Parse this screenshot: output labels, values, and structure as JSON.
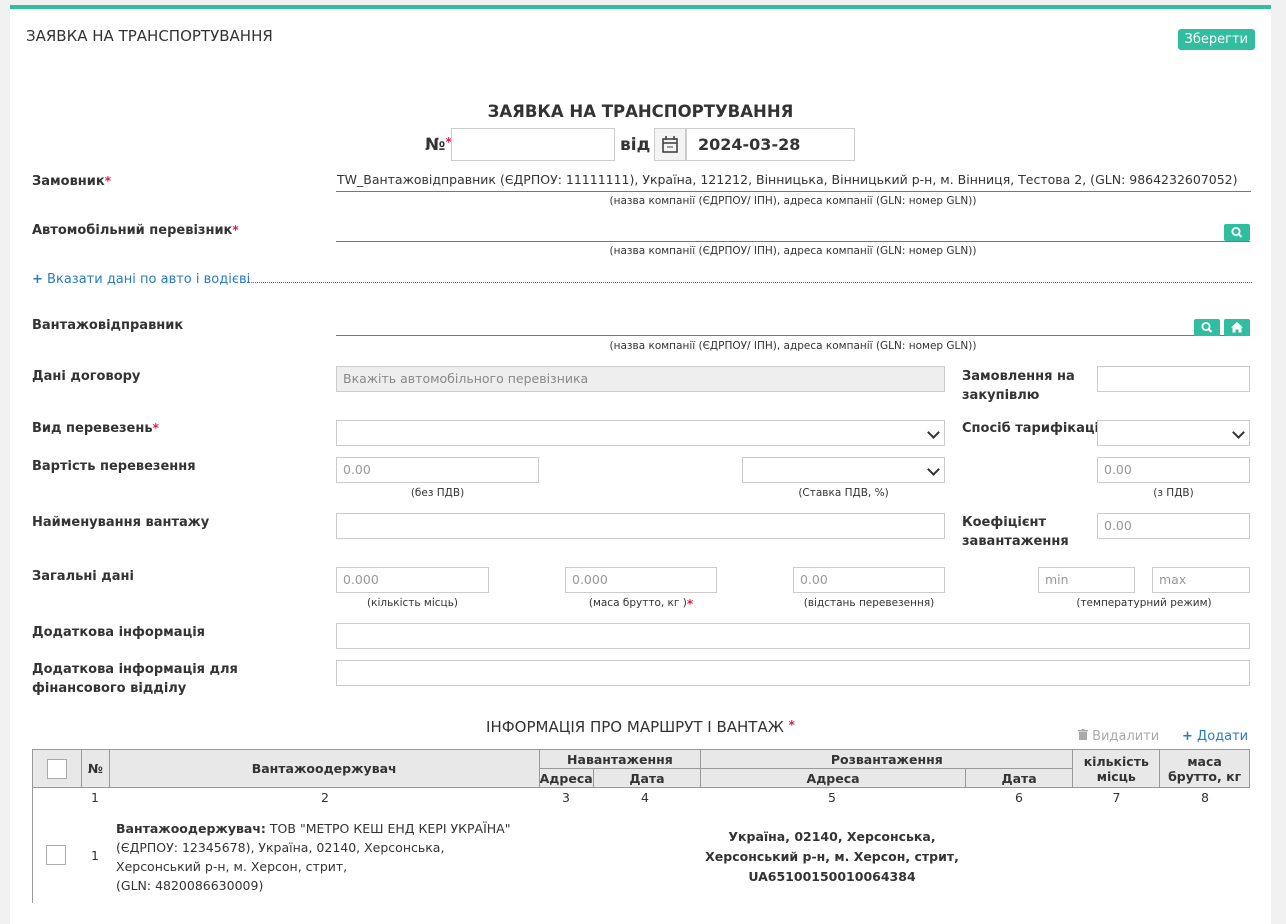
{
  "header": {
    "title": "ЗАЯВКА НА ТРАНСПОРТУВАННЯ",
    "save_label": "Зберегти"
  },
  "doc": {
    "title": "ЗАЯВКА НА ТРАНСПОРТУВАННЯ",
    "number_label": "№",
    "number_value": "",
    "date_label": "від",
    "date_value": "2024-03-28"
  },
  "form": {
    "customer_label": "Замовник",
    "customer_value": "TW_Вантажовідправник (ЄДРПОУ: 11111111), Україна, 121212, Вінницька, Вінницький р-н, м. Вінниця, Тестова 2, (GLN: 9864232607052)",
    "company_hint": "(назва компанії (ЄДРПОУ/ ІПН), адреса компанії (GLN: номер GLN))",
    "carrier_label": "Автомобільний перевізник",
    "carrier_value": "",
    "vehicle_link": "Вказати дані по авто і водієві",
    "shipper_label": "Вантажовідправник",
    "shipper_value": "",
    "contract_label": "Дані договору",
    "contract_placeholder": "Вкажіть автомобільного перевізника",
    "purchase_order_label": "Замовлення на закупівлю",
    "transport_type_label": "Вид перевезень",
    "tariff_label": "Спосіб тарифікації",
    "cost_label": "Вартість перевезення",
    "cost_value": "0.00",
    "cost_hint": "(без ПДВ)",
    "vat_hint": "(Ставка ПДВ, %)",
    "cost_vat_value": "0.00",
    "cost_vat_hint": "(з ПДВ)",
    "cargo_name_label": "Найменування вантажу",
    "load_coef_label": "Коефіцієнт завантаження",
    "load_coef_value": "0.00",
    "general_label": "Загальні дані",
    "places_value": "0.000",
    "places_hint": "(кількість місць)",
    "gross_value": "0.000",
    "gross_hint": "(маса брутто, кг )",
    "distance_value": "0.00",
    "distance_hint": "(відстань перевезення)",
    "temp_min": "min",
    "temp_max": "max",
    "temp_hint": "(температурний режим)",
    "extra_label": "Додаткова інформація",
    "extra_fin_label": "Додаткова інформація для фінансового відділу"
  },
  "route": {
    "title": "ІНФОРМАЦІЯ ПРО МАРШРУТ І ВАНТАЖ",
    "delete_label": "Видалити",
    "add_label": "Додати",
    "headers": {
      "num": "№",
      "consignee": "Вантажоодержувач",
      "loading": "Навантаження",
      "unloading": "Розвантаження",
      "address": "Адреса",
      "date": "Дата",
      "places": "кількість місць",
      "gross": "маса брутто, кг"
    },
    "col_numbers": [
      "1",
      "2",
      "3",
      "4",
      "5",
      "6",
      "7",
      "8"
    ],
    "rows": [
      {
        "num": "1",
        "consignee_label": "Вантажоодержувач:",
        "consignee_text": "ТОВ \"МЕТРО КЕШ ЕНД КЕРІ УКРАЇНА\" (ЄДРПОУ: 12345678), Україна, 02140, Херсонська, Херсонський р-н, м. Херсон, стрит,",
        "consignee_gln": "(GLN: 4820086630009)",
        "unload_address": "Україна, 02140, Херсонська, Херсонський р-н, м. Херсон, стрит, UA65100150010064384"
      }
    ]
  },
  "colors": {
    "accent": "#30bda0",
    "link": "#2a7bbf",
    "required": "#e0194c"
  },
  "icons": [
    "calendar-icon",
    "search-icon",
    "home-icon",
    "plus-icon",
    "trash-icon",
    "chevron-down-icon"
  ]
}
